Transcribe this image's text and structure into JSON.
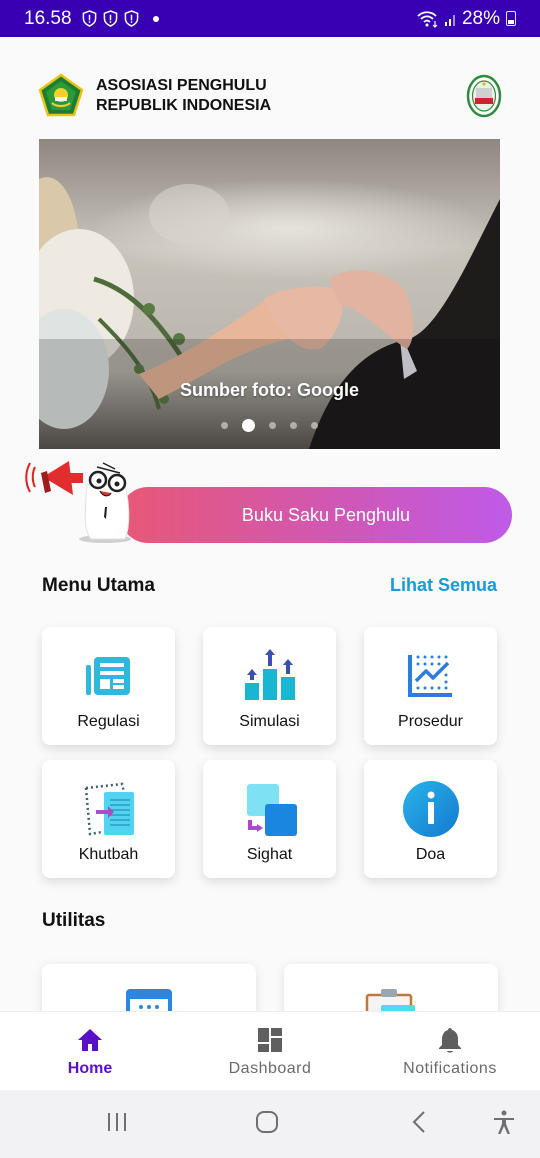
{
  "status_bar": {
    "time": "16.58",
    "battery": "28%",
    "notification_icons": [
      "shield-alert-icon",
      "shield-alert-icon",
      "shield-alert-icon",
      "dot-icon"
    ],
    "system_icons": [
      "wifi-icon",
      "signal-icon",
      "battery-icon"
    ]
  },
  "header": {
    "title_line1": "ASOSIASI PENGHULU",
    "title_line2": "REPUBLIK INDONESIA",
    "left_logo": "kemenag-logo",
    "right_logo": "apri-logo"
  },
  "banner": {
    "caption": "Sumber foto: Google",
    "slide_count": 5,
    "active_slide": 2
  },
  "promo": {
    "label": "Buku Saku Penghulu"
  },
  "menu_utama": {
    "title": "Menu Utama",
    "see_all": "Lihat Semua",
    "items": [
      {
        "label": "Regulasi",
        "icon": "newspaper-icon"
      },
      {
        "label": "Simulasi",
        "icon": "bar-chart-growth-icon"
      },
      {
        "label": "Prosedur",
        "icon": "line-chart-icon"
      },
      {
        "label": "Khutbah",
        "icon": "document-transfer-icon"
      },
      {
        "label": "Sighat",
        "icon": "copy-squares-icon"
      },
      {
        "label": "Doa",
        "icon": "info-icon"
      }
    ]
  },
  "utilitas": {
    "title": "Utilitas",
    "items": [
      {
        "icon": "calendar-icon"
      },
      {
        "icon": "clipboard-icon"
      }
    ]
  },
  "bottom_nav": {
    "items": [
      {
        "label": "Home",
        "icon": "home-icon",
        "active": true
      },
      {
        "label": "Dashboard",
        "icon": "dashboard-icon",
        "active": false
      },
      {
        "label": "Notifications",
        "icon": "bell-icon",
        "active": false
      }
    ]
  },
  "colors": {
    "status_bar": "#3700b3",
    "accent": "#5a10c9",
    "link": "#1a9ad6",
    "promo_gradient_start": "#e85876",
    "promo_gradient_end": "#bf5be8"
  }
}
